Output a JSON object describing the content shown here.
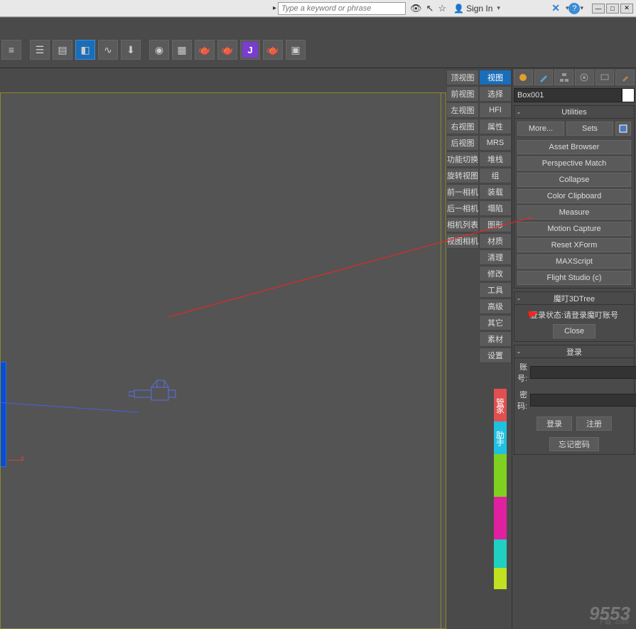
{
  "topbar": {
    "search_placeholder": "Type a keyword or phrase",
    "sign_in": "Sign In"
  },
  "side_menu": {
    "col1": [
      "顶视图",
      "前视图",
      "左视图",
      "右视图",
      "后视图",
      "功能切换",
      "旋转视图",
      "前一相机",
      "后一相机",
      "相机列表",
      "视图相机"
    ],
    "col2": [
      "视图",
      "选择",
      "HFI",
      "属性",
      "MRS",
      "堆栈",
      "组",
      "装载",
      "塌陷",
      "图形",
      "材质",
      "清理",
      "修改",
      "工具",
      "高级",
      "其它",
      "素材",
      "设置"
    ]
  },
  "vertical_badges": [
    "管家",
    "助手"
  ],
  "panel": {
    "object_name": "Box001",
    "utilities_title": "Utilities",
    "more_btn": "More...",
    "sets_btn": "Sets",
    "buttons": [
      "Asset Browser",
      "Perspective Match",
      "Collapse",
      "Color Clipboard",
      "Measure",
      "Motion Capture",
      "Reset XForm",
      "MAXScript",
      "Flight Studio (c)"
    ],
    "tree_title": "魔叮3DTree",
    "tree_status": "登录状态:请登录魔叮账号",
    "close_btn": "Close",
    "login_title": "登录",
    "account_label": "账号:",
    "password_label": "密码:",
    "login_btn": "登录",
    "register_btn": "注册",
    "forgot_btn": "忘记密码"
  },
  "watermark": "9553",
  "watermark_sub": "下载 .com"
}
